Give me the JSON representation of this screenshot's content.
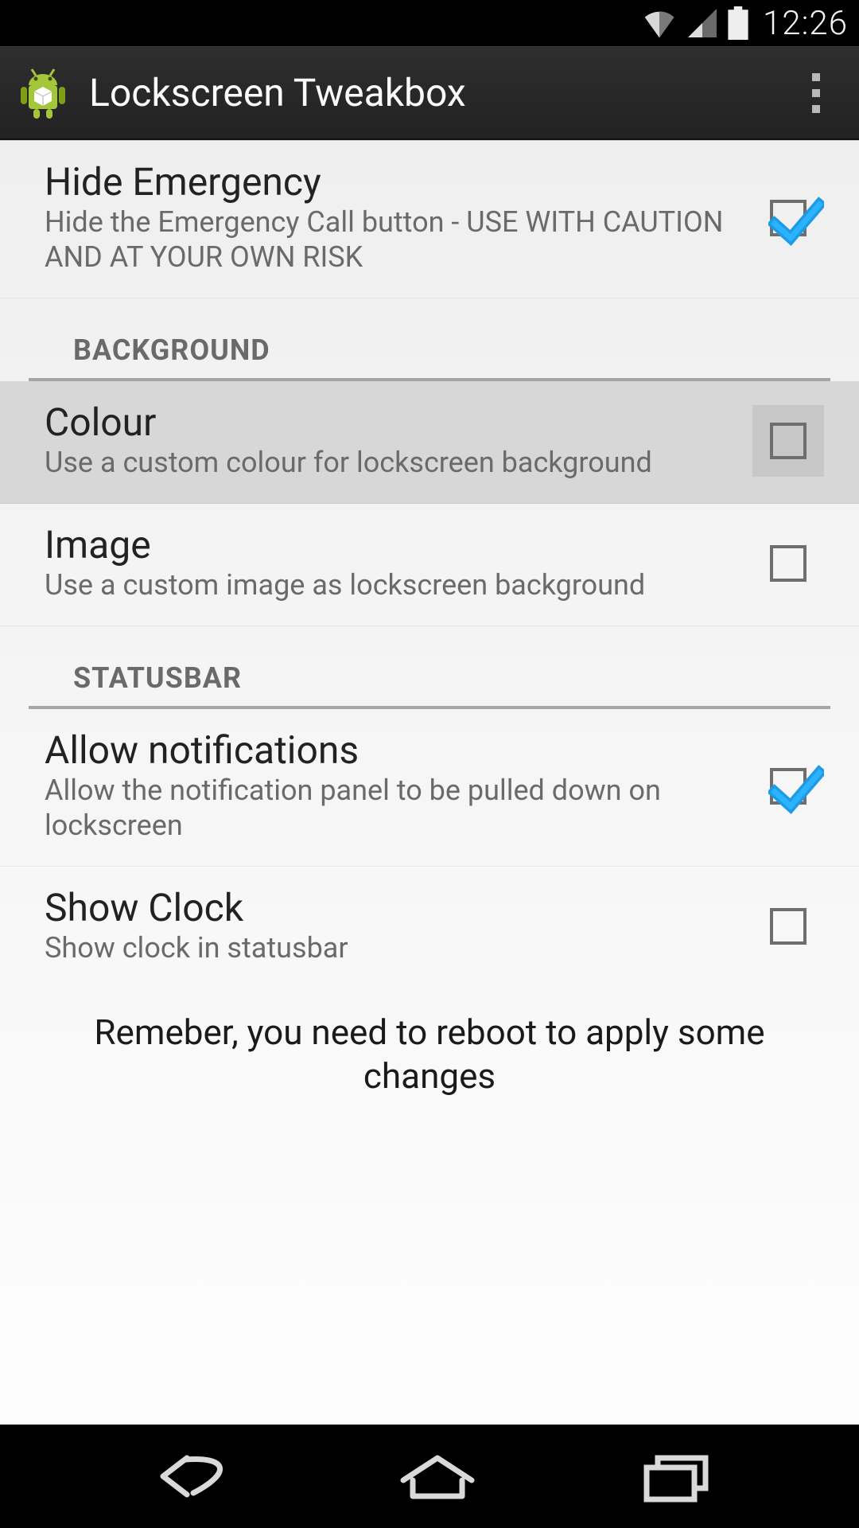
{
  "statusbar": {
    "time": "12:26"
  },
  "actionbar": {
    "title": "Lockscreen Tweakbox"
  },
  "prefs": {
    "hide_emergency": {
      "title": "Hide Emergency",
      "summary": "Hide the Emergency Call button - USE WITH CAUTION AND AT YOUR OWN RISK",
      "checked": true
    },
    "section_background": "BACKGROUND",
    "colour": {
      "title": "Colour",
      "summary": "Use a custom colour for lockscreen background",
      "checked": false,
      "pressed": true
    },
    "image": {
      "title": "Image",
      "summary": "Use a custom image as lockscreen background",
      "checked": false
    },
    "section_statusbar": "STATUSBAR",
    "allow_notifications": {
      "title": "Allow notifications",
      "summary": "Allow the notification panel to be pulled down on lockscreen",
      "checked": true
    },
    "show_clock": {
      "title": "Show Clock",
      "summary": "Show clock in statusbar",
      "checked": false
    }
  },
  "footer": "Remeber, you need to reboot to apply some changes"
}
